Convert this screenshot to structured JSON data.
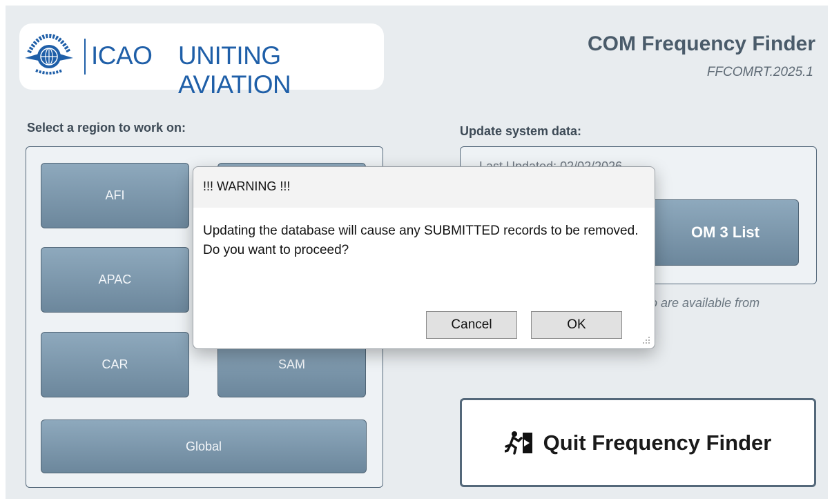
{
  "logo": {
    "acronym": "ICAO",
    "tagline": "UNITING AVIATION"
  },
  "header": {
    "title": "COM Frequency Finder",
    "version": "FFCOMRT.2025.1"
  },
  "regions": {
    "label": "Select a region to work on:",
    "buttons": {
      "afi": "AFI",
      "apac": "APAC",
      "car": "CAR",
      "sam": "SAM",
      "global": "Global"
    }
  },
  "update": {
    "label": "Update system data:",
    "last_updated": "Last Updated: 02/02/2026",
    "com_button": "OM 3 List",
    "note": "o are available from"
  },
  "quit": {
    "label": "Quit Frequency Finder",
    "icon": "exit-door-icon"
  },
  "dialog": {
    "title": "!!!  WARNING  !!!",
    "message": "Updating the database will cause any SUBMITTED records to be removed. Do you want to proceed?",
    "cancel": "Cancel",
    "ok": "OK"
  },
  "colors": {
    "button_top": "#8ea9bd",
    "button_bottom": "#6c879c",
    "brand_blue": "#1f5fa8",
    "panel_border": "#54687a"
  }
}
